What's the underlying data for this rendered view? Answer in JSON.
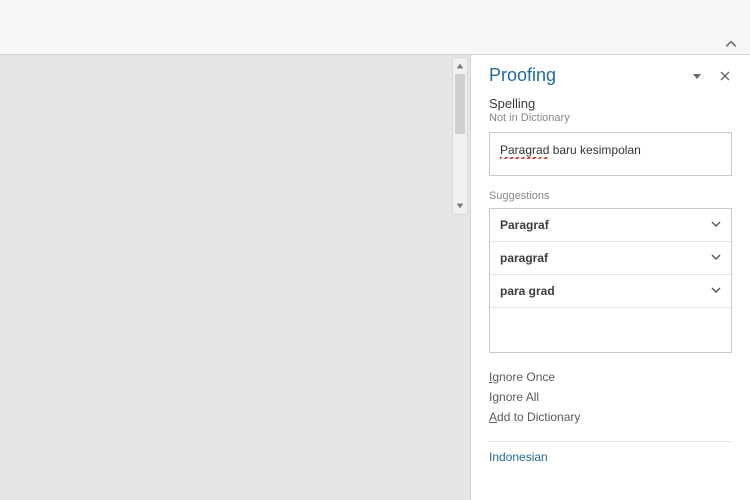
{
  "pane": {
    "title": "Proofing",
    "section": "Spelling",
    "status": "Not in Dictionary",
    "sentence_error": "Paragrad",
    "sentence_rest": " baru kesimpolan",
    "suggestions_label": "Suggestions",
    "suggestions": [
      "Paragraf",
      "paragraf",
      "para grad"
    ],
    "actions": {
      "ignore_once": "Ignore Once",
      "ignore_all": "Ignore All",
      "add_dict": "Add to Dictionary"
    },
    "language": "Indonesian"
  }
}
